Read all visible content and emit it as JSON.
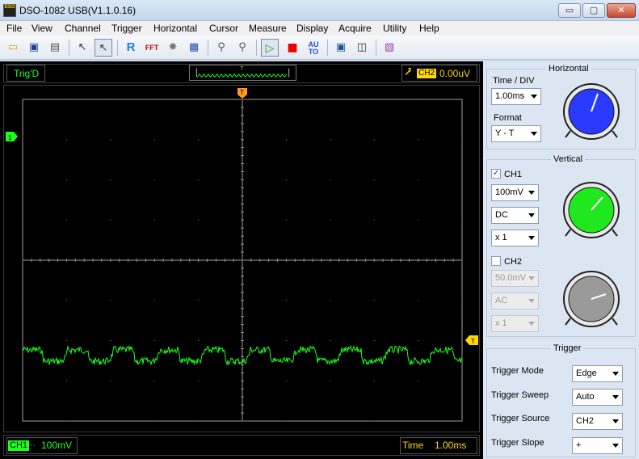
{
  "window": {
    "title": "DSO-1082 USB(V1.1.0.16)",
    "icon_text": "DSO",
    "controls": {
      "minimize": "▭",
      "maximize": "▢",
      "close": "✕"
    }
  },
  "menu": [
    "File",
    "View",
    "Channel",
    "Trigger",
    "Horizontal",
    "Cursor",
    "Measure",
    "Display",
    "Acquire",
    "Utility",
    "Help"
  ],
  "toolbar": {
    "icons": [
      "open-folder-icon",
      "save-icon",
      "print-icon",
      "cursor-select-icon",
      "arrow-pointer-icon",
      "reference-icon",
      "fft-icon",
      "math-icon",
      "xy-mode-icon",
      "zoom-in-icon",
      "zoom-out-icon",
      "run-icon",
      "stop-icon",
      "auto-icon",
      "screenshot-icon",
      "window-icon",
      "book-icon"
    ],
    "reference_label": "R",
    "fft_label": "FFT",
    "auto_label_top": "AU",
    "auto_label_bottom": "TO"
  },
  "scope": {
    "status": "Trig'D",
    "trigger_marker": "T",
    "trigger_source_tag": "CH2",
    "trigger_value": "0.00uV",
    "ch1_marker": "1",
    "bottom": {
      "ch1_tag": "CH1",
      "ch1_coupling": "",
      "ch1_volts": "100mV",
      "time_label": "Time",
      "time_value": "1.00ms"
    },
    "colors": {
      "ch1": "#1bff1b",
      "trigger": "#ffd800",
      "grid": "#8c8c8c"
    }
  },
  "panel": {
    "horizontal": {
      "title": "Horizontal",
      "time_div_label": "Time / DIV",
      "time_div_value": "1.00ms",
      "format_label": "Format",
      "format_value": "Y - T",
      "knob_color": "#2a3bff"
    },
    "vertical": {
      "title": "Vertical",
      "ch1": {
        "label": "CH1",
        "checked": true,
        "volts": "100mV",
        "coupling": "DC",
        "probe": "x 1",
        "knob_color": "#1fe81f"
      },
      "ch2": {
        "label": "CH2",
        "checked": false,
        "volts": "50.0mV",
        "coupling": "AC",
        "probe": "x 1",
        "knob_color": "#9a9a9a"
      }
    },
    "trigger": {
      "title": "Trigger",
      "mode_label": "Trigger Mode",
      "mode_value": "Edge",
      "sweep_label": "Trigger Sweep",
      "sweep_value": "Auto",
      "source_label": "Trigger Source",
      "source_value": "CH2",
      "slope_label": "Trigger Slope",
      "slope_value": "+"
    }
  }
}
